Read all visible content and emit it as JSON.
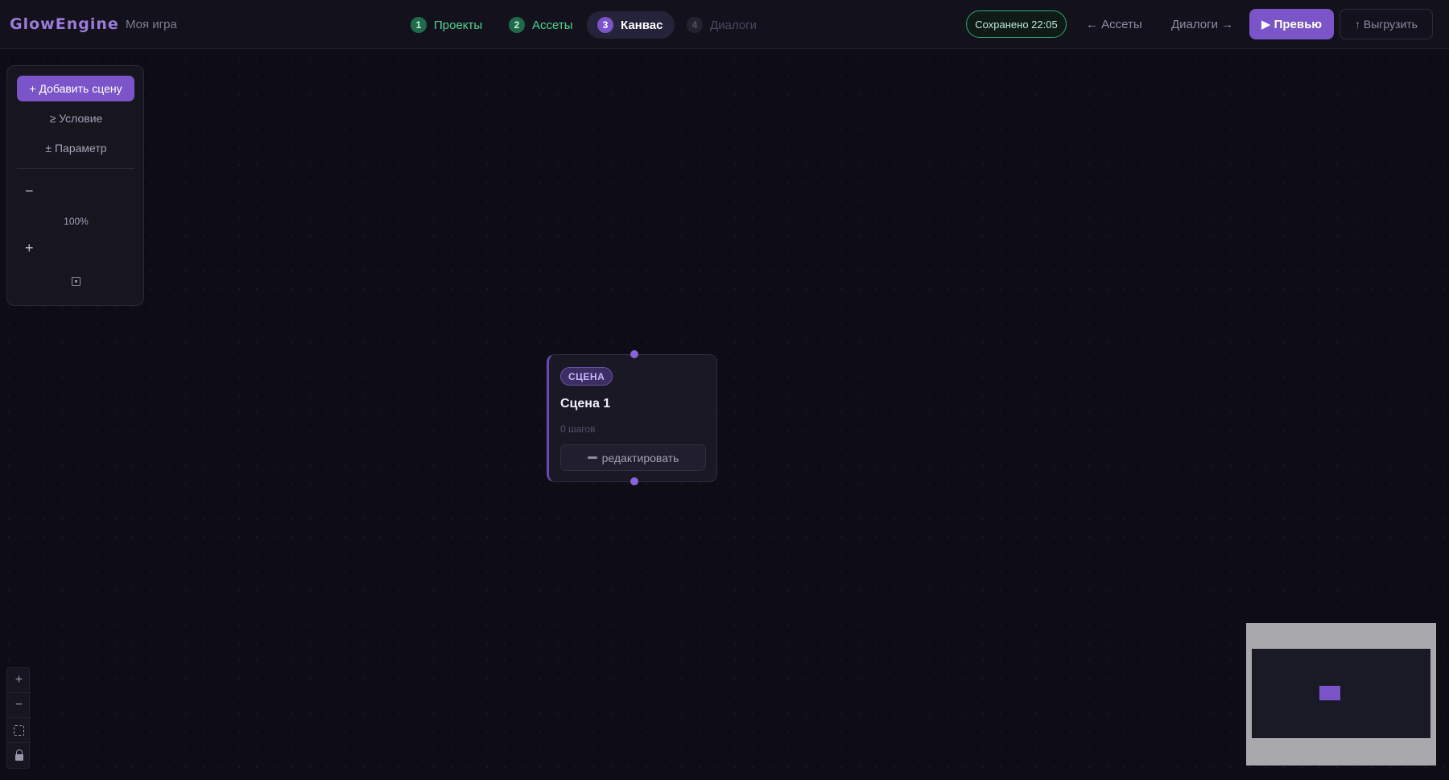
{
  "app": {
    "logo": "GlowEngine",
    "separator": "·",
    "project_name": "Моя игра"
  },
  "steps": [
    {
      "num": "1",
      "label": "Проекты",
      "state": "done"
    },
    {
      "num": "2",
      "label": "Ассеты",
      "state": "done"
    },
    {
      "num": "3",
      "label": "Канвас",
      "state": "active"
    },
    {
      "num": "4",
      "label": "Диалоги",
      "state": "todo"
    }
  ],
  "header": {
    "saved_status": "Сохранено 22:05",
    "back_link": "← Ассеты",
    "next_link": "Диалоги →",
    "preview_label": "▶ Превью",
    "export_label": "↑ Выгрузить"
  },
  "tools": {
    "add_scene": "+ Добавить сцену",
    "condition": "≥ Условие",
    "parameter": "± Параметр",
    "zoom_out": "−",
    "zoom_level": "100%",
    "zoom_in": "+"
  },
  "node": {
    "badge": "СЦЕНА",
    "title": "Сцена 1",
    "subtitle": "0 шагов",
    "edit_label": "редактировать"
  },
  "controls": {
    "zoom_in": "+",
    "zoom_out": "−"
  },
  "colors": {
    "accent": "#7b54c9",
    "success": "#4fd394",
    "background": "#0e0d16"
  }
}
